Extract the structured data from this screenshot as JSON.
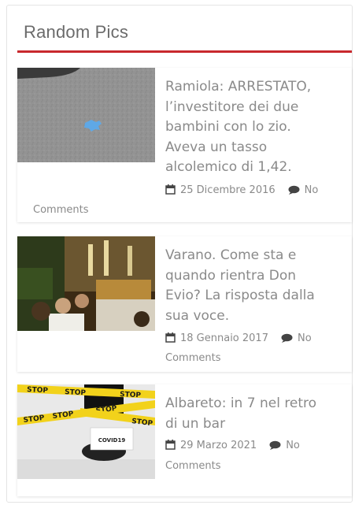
{
  "widget": {
    "title": "Random Pics"
  },
  "posts": [
    {
      "title": "Ramiola: ARRESTATO, l’investitore dei due bambini con lo zio. Aveva un tasso alcolemico di 1,42.",
      "date": "25 Dicembre 2016",
      "comments": "No Comments",
      "comments_first": "No",
      "comments_second": "Comments"
    },
    {
      "title": "Varano. Come sta e quando rientra Don Evio? La risposta dalla sua voce.",
      "date": "18 Gennaio 2017",
      "comments_first": "No",
      "comments_second": "Comments"
    },
    {
      "title": "Albareto: in 7 nel retro di un bar",
      "date": "29 Marzo 2021",
      "comments_first": "No",
      "comments_second": "Comments",
      "image_text": {
        "tape": "STOP",
        "sign": "COVID19"
      }
    }
  ],
  "colors": {
    "accent": "#c8282d",
    "text": "#8a8a8a",
    "title": "#6b6b6b"
  }
}
